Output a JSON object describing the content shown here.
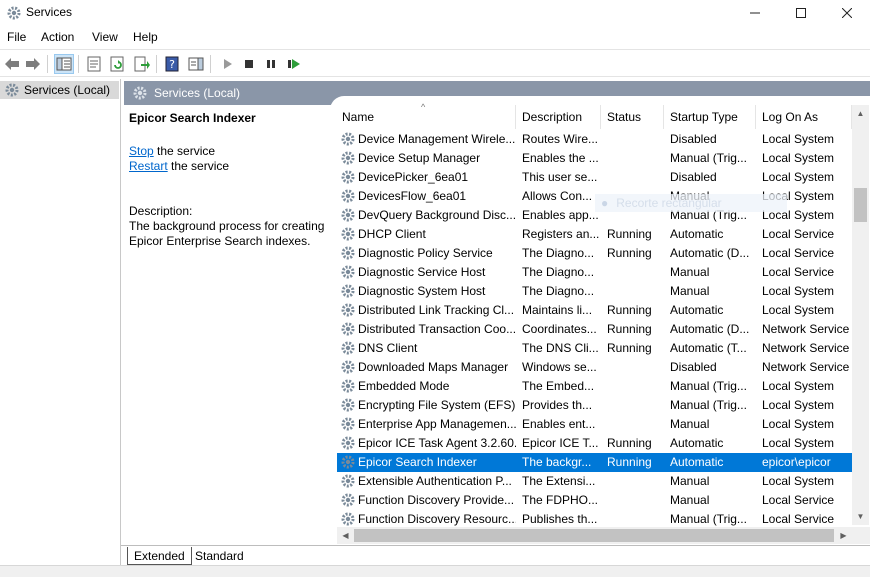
{
  "window": {
    "title": "Services"
  },
  "menu": [
    "File",
    "Action",
    "View",
    "Help"
  ],
  "tree": {
    "item": "Services (Local)"
  },
  "panel": {
    "header": "Services (Local)"
  },
  "details": {
    "service_name": "Epicor Search Indexer",
    "stop_link": "Stop",
    "stop_suffix": " the service",
    "restart_link": "Restart",
    "restart_suffix": " the service",
    "description_label": "Description:",
    "description_text": "The background process for creating Epicor Enterprise Search indexes."
  },
  "columns": [
    "Name",
    "Description",
    "Status",
    "Startup Type",
    "Log On As"
  ],
  "services": [
    [
      "Device Management Wirele...",
      "Routes Wire...",
      "",
      "Disabled",
      "Local System"
    ],
    [
      "Device Setup Manager",
      "Enables the ...",
      "",
      "Manual (Trig...",
      "Local System"
    ],
    [
      "DevicePicker_6ea01",
      "This user se...",
      "",
      "Disabled",
      "Local System"
    ],
    [
      "DevicesFlow_6ea01",
      "Allows Con...",
      "",
      "Manual",
      "Local System"
    ],
    [
      "DevQuery Background Disc...",
      "Enables app...",
      "",
      "Manual (Trig...",
      "Local System"
    ],
    [
      "DHCP Client",
      "Registers an...",
      "Running",
      "Automatic",
      "Local Service"
    ],
    [
      "Diagnostic Policy Service",
      "The Diagno...",
      "Running",
      "Automatic (D...",
      "Local Service"
    ],
    [
      "Diagnostic Service Host",
      "The Diagno...",
      "",
      "Manual",
      "Local Service"
    ],
    [
      "Diagnostic System Host",
      "The Diagno...",
      "",
      "Manual",
      "Local System"
    ],
    [
      "Distributed Link Tracking Cl...",
      "Maintains li...",
      "Running",
      "Automatic",
      "Local System"
    ],
    [
      "Distributed Transaction Coo...",
      "Coordinates...",
      "Running",
      "Automatic (D...",
      "Network Service"
    ],
    [
      "DNS Client",
      "The DNS Cli...",
      "Running",
      "Automatic (T...",
      "Network Service"
    ],
    [
      "Downloaded Maps Manager",
      "Windows se...",
      "",
      "Disabled",
      "Network Service"
    ],
    [
      "Embedded Mode",
      "The Embed...",
      "",
      "Manual (Trig...",
      "Local System"
    ],
    [
      "Encrypting File System (EFS)",
      "Provides th...",
      "",
      "Manual (Trig...",
      "Local System"
    ],
    [
      "Enterprise App Managemen...",
      "Enables ent...",
      "",
      "Manual",
      "Local System"
    ],
    [
      "Epicor ICE Task Agent 3.2.60...",
      "Epicor ICE T...",
      "Running",
      "Automatic",
      "Local System"
    ],
    [
      "Epicor Search Indexer",
      "The backgr...",
      "Running",
      "Automatic",
      "epicor\\epicor"
    ],
    [
      "Extensible Authentication P...",
      "The Extensi...",
      "",
      "Manual",
      "Local System"
    ],
    [
      "Function Discovery Provide...",
      "The FDPHO...",
      "",
      "Manual",
      "Local Service"
    ],
    [
      "Function Discovery Resourc...",
      "Publishes th...",
      "",
      "Manual (Trig...",
      "Local Service"
    ]
  ],
  "selected_index": 17,
  "overlay": {
    "ghost_text": "Recorte rectangular"
  },
  "tabs": [
    "Extended",
    "Standard"
  ],
  "colors": {
    "selection": "#0078d7",
    "header": "#8a96a8",
    "link": "#0066cc"
  }
}
